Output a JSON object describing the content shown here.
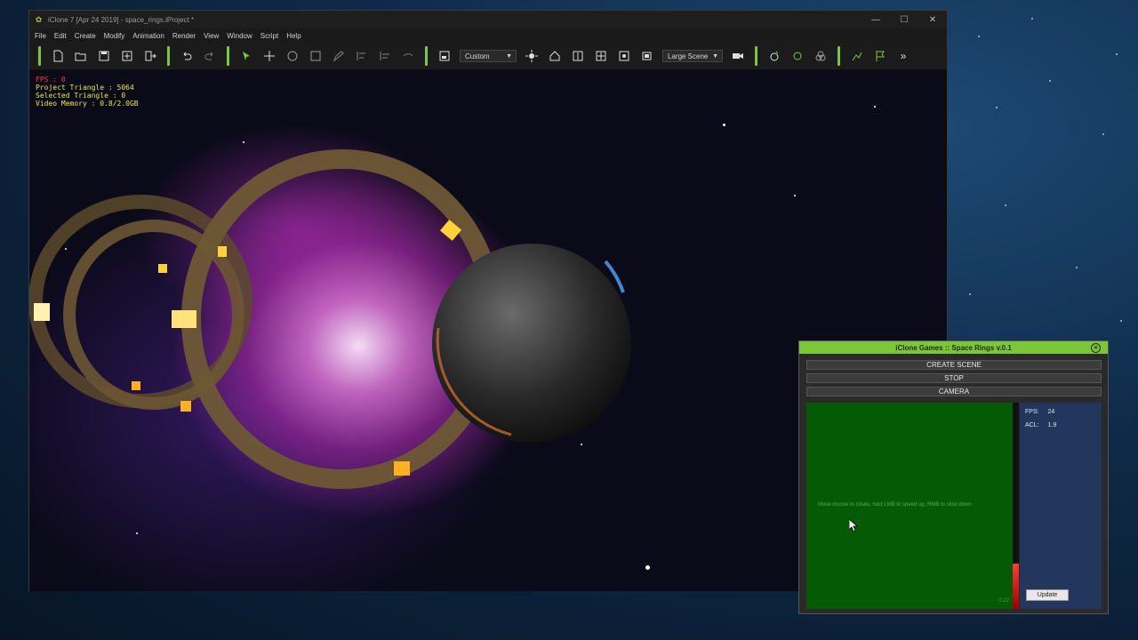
{
  "window": {
    "title": "iClone 7 [Apr 24 2019] - space_rings.iProject *",
    "controls": [
      "minimize-icon",
      "maximize-icon",
      "close-icon"
    ]
  },
  "menu": [
    "File",
    "Edit",
    "Create",
    "Modify",
    "Animation",
    "Render",
    "View",
    "Window",
    "Script",
    "Help"
  ],
  "toolbar": {
    "view_mode": "Custom",
    "scene_size": "Large Scene",
    "more_label": "»"
  },
  "viewport": {
    "fps_line": "FPS : 0",
    "project_triangle": "Project Triangle : 5064",
    "selected_triangle": "Selected Triangle : 0",
    "video_memory": "Video Memory : 0.8/2.0GB"
  },
  "panel": {
    "title": "iClone Games :: Space Rings v.0.1",
    "create_scene": "CREATE SCENE",
    "stop": "STOP",
    "camera": "CAMERA",
    "instructions": "Move mouse to rotate, hold LMB to speed up, RMB to slow down",
    "speed_value": "0.22",
    "fps_label": "FPS:",
    "fps_value": "24",
    "acl_label": "ACL:",
    "acl_value": "1.9",
    "update": "Update",
    "meter_level": 0.22,
    "colors": {
      "title_bg": "#7cc63a",
      "green_area": "#055a05",
      "side_area": "#23375e",
      "meter": "#ff3b3b"
    }
  }
}
